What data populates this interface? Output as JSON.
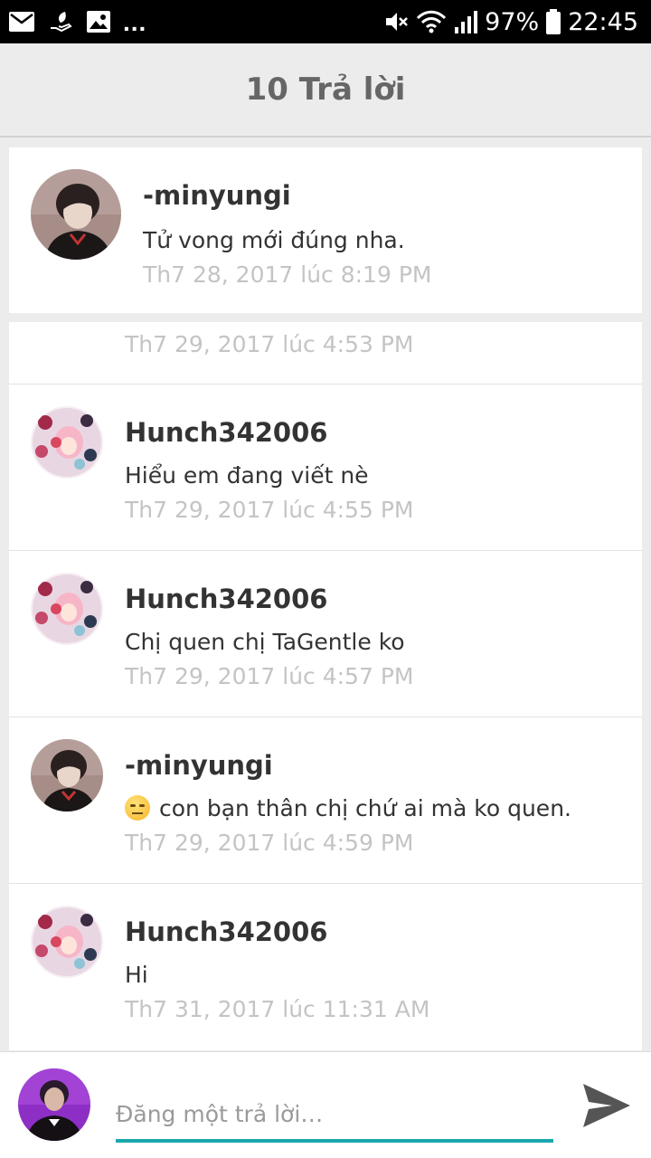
{
  "status_bar": {
    "battery": "97%",
    "time": "22:45",
    "overflow": "...",
    "icons": [
      "mail-icon",
      "hand-leaf-icon",
      "image-icon",
      "mute-icon",
      "wifi-icon",
      "signal-icon",
      "battery-icon"
    ]
  },
  "header": {
    "title": "10 Trả lời"
  },
  "parent_comment": {
    "author": "-minyungi",
    "text": "Tử vong mới đúng nha.",
    "time": "Th7 28, 2017 lúc 8:19 PM"
  },
  "replies": [
    {
      "author": "",
      "text": "",
      "time": "Th7 29, 2017 lúc 4:53 PM"
    },
    {
      "author": "Hunch342006",
      "text": "Hiểu em đang viết nè",
      "time": "Th7 29, 2017 lúc 4:55 PM"
    },
    {
      "author": "Hunch342006",
      "text": "Chị quen chị TaGentle ko",
      "time": "Th7 29, 2017 lúc 4:57 PM"
    },
    {
      "author": "-minyungi",
      "text": "con bạn thân chị chứ ai mà ko quen.",
      "time": "Th7 29, 2017 lúc 4:59 PM",
      "emoji": "expressionless-face-icon"
    },
    {
      "author": "Hunch342006",
      "text": "Hi",
      "time": "Th7 31, 2017 lúc 11:31 AM"
    }
  ],
  "reply_bar": {
    "placeholder": "Đăng một trả lời…",
    "accent_color": "#1aa7ad"
  },
  "colors": {
    "status_bar": "#000000",
    "header_bg": "#ececec",
    "title_text": "#666666",
    "timestamp": "#c4c4c4",
    "send_icon": "#555555"
  }
}
